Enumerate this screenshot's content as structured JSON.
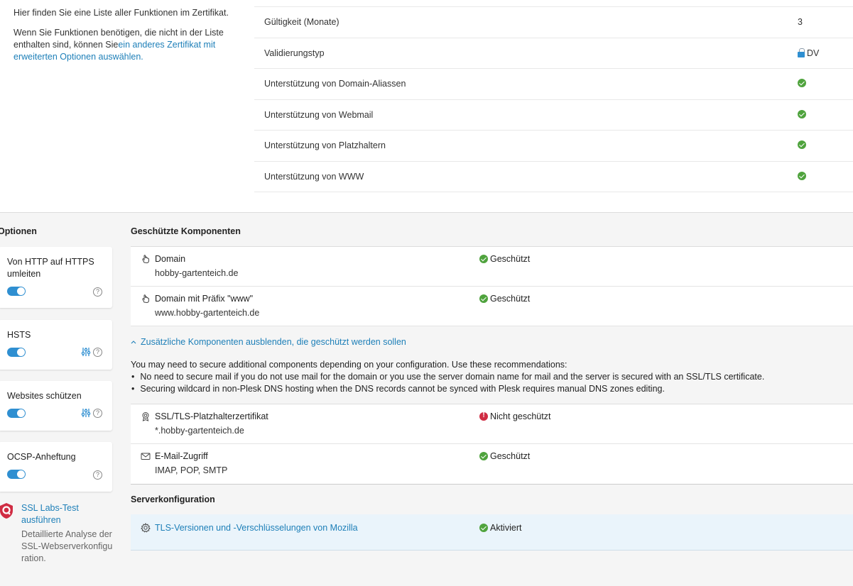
{
  "intro": {
    "line1": "Hier finden Sie eine Liste aller Funktionen im Zertifikat.",
    "line2_prefix": "Wenn Sie Funktionen benötigen, die nicht in der Liste enthalten sind, können Sie",
    "line2_link": "ein anderes Zertifikat mit erweiterten Optionen auswählen."
  },
  "features": [
    {
      "name": "Gültigkeit (Monate)",
      "value": "3"
    },
    {
      "name": "Validierungstyp",
      "value": "DV",
      "icon": "lock-icon"
    },
    {
      "name": "Unterstützung von Domain-Aliassen",
      "icon": "check-icon"
    },
    {
      "name": "Unterstützung von Webmail",
      "icon": "check-icon"
    },
    {
      "name": "Unterstützung von Platzhaltern",
      "icon": "check-icon"
    },
    {
      "name": "Unterstützung von WWW",
      "icon": "check-icon"
    }
  ],
  "options": {
    "title": "Optionen",
    "items": [
      {
        "label": "Von HTTP auf HTTPS umleiten",
        "enabled": true,
        "tune": false
      },
      {
        "label": "HSTS",
        "enabled": true,
        "tune": true
      },
      {
        "label": "Websites schützen",
        "enabled": true,
        "tune": true
      },
      {
        "label": "OCSP-Anheftung",
        "enabled": true,
        "tune": false
      }
    ],
    "ssl_test": {
      "link": "SSL Labs-Test ausführen",
      "desc": "Detaillierte Analyse der SSL-Webserverkonfiguration."
    }
  },
  "protected": {
    "title": "Geschützte Komponenten",
    "rows": [
      {
        "name": "Domain",
        "sub": "hobby-gartenteich.de",
        "status": "Geschützt"
      },
      {
        "name": "Domain mit Präfix \"www\"",
        "sub": "www.hobby-gartenteich.de",
        "status": "Geschützt"
      }
    ],
    "toggle_label": "Zusätzliche Komponenten ausblenden, die geschützt werden sollen",
    "notes_intro": "You may need to secure additional components depending on your configuration. Use these recommendations:",
    "notes": [
      "No need to secure mail if you do not use mail for the domain or you use the server domain name for mail and the server is secured with an SSL/TLS certificate.",
      "Securing wildcard in non-Plesk DNS hosting when the DNS records cannot be synced with Plesk requires manual DNS zones editing."
    ],
    "extra_rows": [
      {
        "name": "SSL/TLS-Platzhalterzertifikat",
        "sub": "*.hobby-gartenteich.de",
        "status": "Nicht geschützt"
      },
      {
        "name": "E-Mail-Zugriff",
        "sub": "IMAP, POP, SMTP",
        "status": "Geschützt"
      }
    ]
  },
  "server": {
    "title": "Serverkonfiguration",
    "row_link": "TLS-Versionen und -Verschlüsselungen von Mozilla",
    "row_status": "Aktiviert"
  },
  "colors": {
    "accent": "#2f8fd1",
    "success": "#4fa33d",
    "danger": "#d02c43",
    "link": "#1d7fb8"
  }
}
